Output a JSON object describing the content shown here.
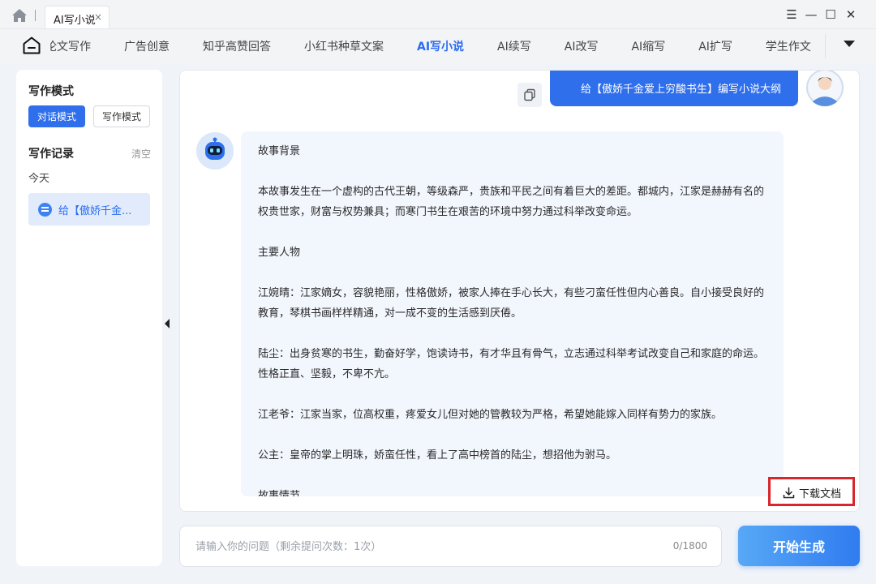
{
  "titlebar": {
    "tab_label": "AI写小说",
    "close_glyph": "×",
    "controls": {
      "menu": "☰",
      "minimize": "—",
      "maximize": "☐",
      "close": "✕"
    }
  },
  "nav": {
    "items": [
      "论文写作",
      "广告创意",
      "知乎高赞回答",
      "小红书种草文案",
      "AI写小说",
      "AI续写",
      "AI改写",
      "AI缩写",
      "AI扩写",
      "学生作文"
    ],
    "active": "AI写小说"
  },
  "sidebar": {
    "mode_title": "写作模式",
    "mode_active": "对话模式",
    "mode_other": "写作模式",
    "records_title": "写作记录",
    "clear_label": "清空",
    "today_label": "今天",
    "record_item": "给【傲娇千金..."
  },
  "chat": {
    "user_message": "给【傲娇千金爱上穷酸书生】编写小说大纲",
    "bot_paragraphs": [
      "故事背景",
      "本故事发生在一个虚构的古代王朝，等级森严，贵族和平民之间有着巨大的差距。都城内，江家是赫赫有名的权贵世家，财富与权势兼具；而寒门书生在艰苦的环境中努力通过科举改变命运。",
      "主要人物",
      "江婉晴：江家嫡女，容貌艳丽，性格傲娇，被家人捧在手心长大，有些刁蛮任性但内心善良。自小接受良好的教育，琴棋书画样样精通，对一成不变的生活感到厌倦。",
      "陆尘：出身贫寒的书生，勤奋好学，饱读诗书，有才华且有骨气，立志通过科举考试改变自己和家庭的命运。性格正直、坚毅，不卑不亢。",
      "江老爷：江家当家，位高权重，疼爱女儿但对她的管教较为严格，希望她能嫁入同样有势力的家族。",
      "公主：皇帝的掌上明珠，娇蛮任性，看上了高中榜首的陆尘，想招他为驸马。",
      "故事情节"
    ],
    "download_label": "下载文档"
  },
  "input": {
    "placeholder": "请输入你的问题（剩余提问次数：1次）",
    "value": "",
    "char_count": "0/1800"
  },
  "generate_label": "开始生成",
  "colors": {
    "primary": "#2f6fec",
    "highlight": "#d9262c"
  }
}
